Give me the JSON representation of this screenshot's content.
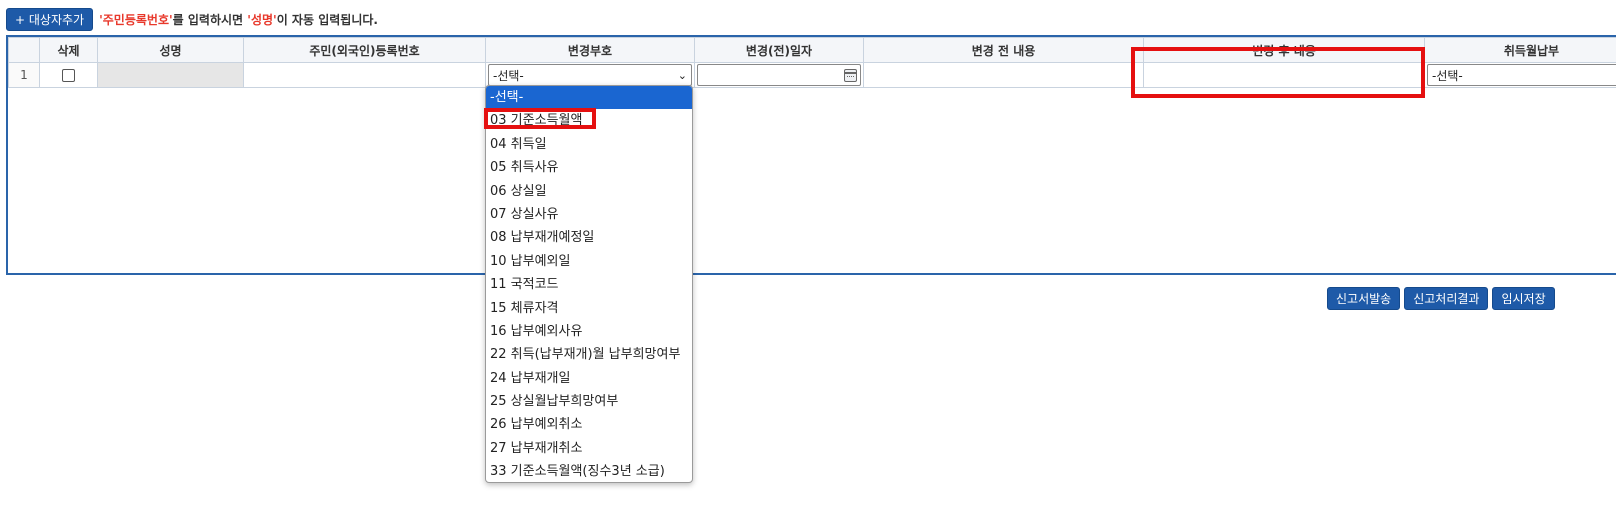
{
  "toolbar": {
    "add_button": "+ 대상자추가",
    "hint_part1": "'주민등록번호'",
    "hint_part2": "를 입력하시면 ",
    "hint_part3": "'성명'",
    "hint_part4": "이 자동 입력됩니다."
  },
  "table": {
    "headers": [
      "",
      "삭제",
      "성명",
      "주민(외국인)등록번호",
      "변경부호",
      "변경(전)일자",
      "변경 전 내용",
      "변경 후 내용",
      "취득월납부"
    ],
    "row": {
      "number": "1",
      "change_code_value": "-선택-",
      "acq_month_value": "-선택-"
    }
  },
  "dropdown": {
    "options": [
      "-선택-",
      "03 기준소득월액",
      "04 취득일",
      "05 취득사유",
      "06 상실일",
      "07 상실사유",
      "08 납부재개예정일",
      "10 납부예외일",
      "11 국적코드",
      "15 체류자격",
      "16 납부예외사유",
      "22 취득(납부재개)월 납부희망여부",
      "24 납부재개일",
      "25 상실월납부희망여부",
      "26 납부예외취소",
      "27 납부재개취소",
      "33 기준소득월액(징수3년 소급)"
    ],
    "selected_index": 0
  },
  "actions": {
    "send": "신고서발송",
    "result": "신고처리결과",
    "save": "임시저장"
  },
  "icons": {
    "calendar": "calendar-icon",
    "chevron": "chevron-down-icon"
  },
  "colors": {
    "accent": "#1e5aa8",
    "highlight_red": "#e51010",
    "hint_red": "#e8382b",
    "selected_option": "#1a66d1"
  }
}
